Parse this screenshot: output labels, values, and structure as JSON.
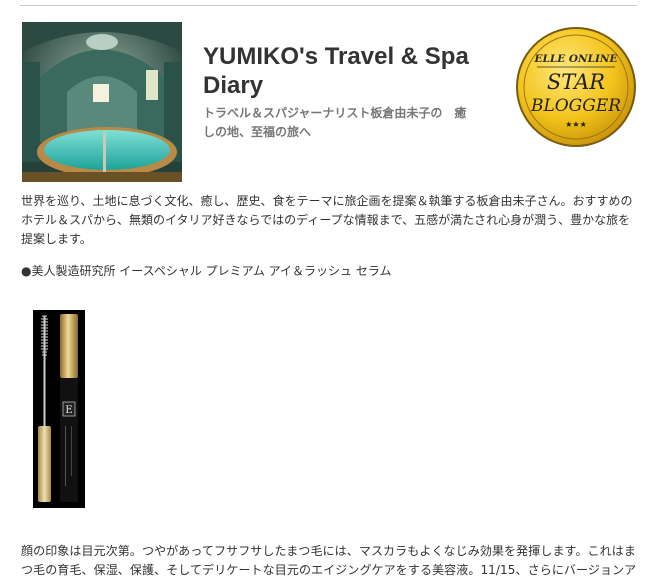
{
  "header": {
    "title": "YUMIKO's Travel & Spa Diary",
    "subtitle": "トラベル＆スパジャーナリスト板倉由未子の　癒しの地、至福の旅へ"
  },
  "badge": {
    "line1": "ELLE ONLINE",
    "line2": "STAR",
    "line3": "BLOGGER",
    "stars": "★★★",
    "color": "#f3c41c"
  },
  "intro": {
    "text": "世界を巡り、土地に息づく文化、癒し、歴史、食をテーマに旅企画を提案＆執筆する板倉由未子さん。おすすめのホテル＆スパから、無類のイタリア好きならではのディープな情報まで、五感が満たされ心身が潤う、豊かな旅を提案します。"
  },
  "post": {
    "product_heading": "●美人製造研究所 イースペシャル プレミアム アイ＆ラッシュ セラム",
    "product_logo": "E",
    "body": "顔の印象は目元次第。つやがあってフサフサしたまつ毛には、マスカラもよくなじみ効果を発揮します。これはまつ毛の育毛、保湿、保護、そしてデリケートな目元のエイジングケアをする美容液。11/15、さらにバージョンア"
  }
}
